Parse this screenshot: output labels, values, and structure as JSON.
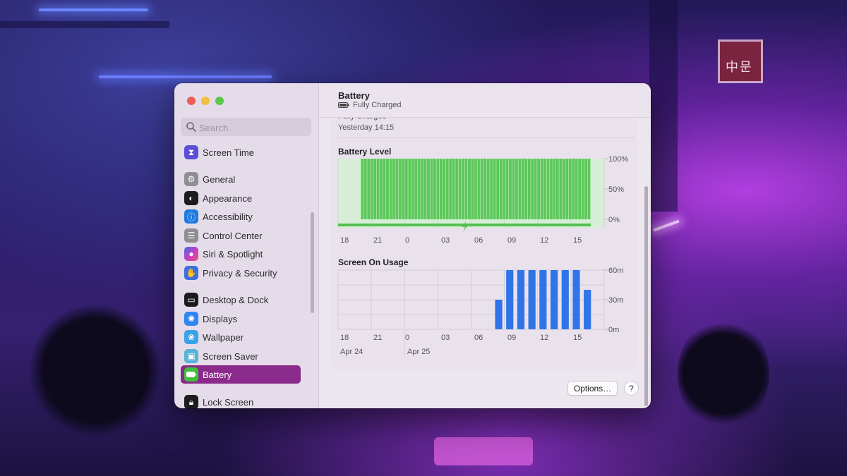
{
  "sidebar": {
    "search_placeholder": "Search",
    "items": [
      {
        "label": "Screen Time",
        "icon": "hourglass-icon",
        "color": "#5b4fd6"
      },
      {
        "label": "General",
        "icon": "gear-icon",
        "color": "#8e8e93"
      },
      {
        "label": "Appearance",
        "icon": "appearance-icon",
        "color": "#1c1c1e"
      },
      {
        "label": "Accessibility",
        "icon": "accessibility-icon",
        "color": "#1f7ae0"
      },
      {
        "label": "Control Center",
        "icon": "control-center-icon",
        "color": "#8e8e93"
      },
      {
        "label": "Siri & Spotlight",
        "icon": "siri-icon",
        "color": "#c13ec8"
      },
      {
        "label": "Privacy & Security",
        "icon": "hand-icon",
        "color": "#3d6fe0"
      },
      {
        "label": "Desktop & Dock",
        "icon": "dock-icon",
        "color": "#1c1c1e"
      },
      {
        "label": "Displays",
        "icon": "sun-icon",
        "color": "#2f86f0"
      },
      {
        "label": "Wallpaper",
        "icon": "wallpaper-icon",
        "color": "#3aa3e8"
      },
      {
        "label": "Screen Saver",
        "icon": "screen-saver-icon",
        "color": "#57b2d8"
      },
      {
        "label": "Battery",
        "icon": "battery-icon",
        "color": "#3fbf3a"
      },
      {
        "label": "Lock Screen",
        "icon": "lock-icon",
        "color": "#1c1c1e"
      }
    ],
    "selected": "Battery",
    "accent": "#8a2b8c"
  },
  "header": {
    "title": "Battery",
    "status": "Fully Charged"
  },
  "last_charged": {
    "label": "Fully Charged",
    "time": "Yesterday 14:15"
  },
  "battery_level": {
    "title": "Battery Level",
    "y_labels": [
      "100%",
      "50%",
      "0%"
    ],
    "x_labels": [
      "18",
      "21",
      "0",
      "03",
      "06",
      "09",
      "12",
      "15"
    ]
  },
  "screen_on": {
    "title": "Screen On Usage",
    "y_labels": [
      "60m",
      "30m",
      "0m"
    ],
    "x_labels": [
      "18",
      "21",
      "0",
      "03",
      "06",
      "09",
      "12",
      "15"
    ],
    "dates": [
      "Apr 24",
      "Apr 25"
    ]
  },
  "buttons": {
    "options": "Options…",
    "help": "?"
  },
  "chart_data": [
    {
      "type": "bar",
      "title": "Battery Level",
      "ylabel": "",
      "xlabel": "",
      "ylim": [
        0,
        100
      ],
      "x_ticks": [
        "18",
        "21",
        "0",
        "03",
        "06",
        "09",
        "12",
        "15"
      ],
      "charging_start_hour": 20,
      "bar_count": 73,
      "values_percent": 100,
      "color": "#5cc85a",
      "charging_indicator": "bolt"
    },
    {
      "type": "bar",
      "title": "Screen On Usage",
      "ylabel": "",
      "xlabel": "",
      "ylim": [
        0,
        60
      ],
      "unit": "minutes",
      "categories": [
        "18",
        "19",
        "20",
        "21",
        "22",
        "23",
        "0",
        "01",
        "02",
        "03",
        "04",
        "05",
        "06",
        "07",
        "08",
        "09",
        "10",
        "11",
        "12",
        "13",
        "14",
        "15",
        "16"
      ],
      "values": [
        0,
        0,
        0,
        0,
        0,
        0,
        0,
        0,
        0,
        0,
        0,
        0,
        0,
        0,
        30,
        60,
        60,
        60,
        60,
        60,
        60,
        60,
        40
      ],
      "color": "#2f74e8"
    }
  ]
}
